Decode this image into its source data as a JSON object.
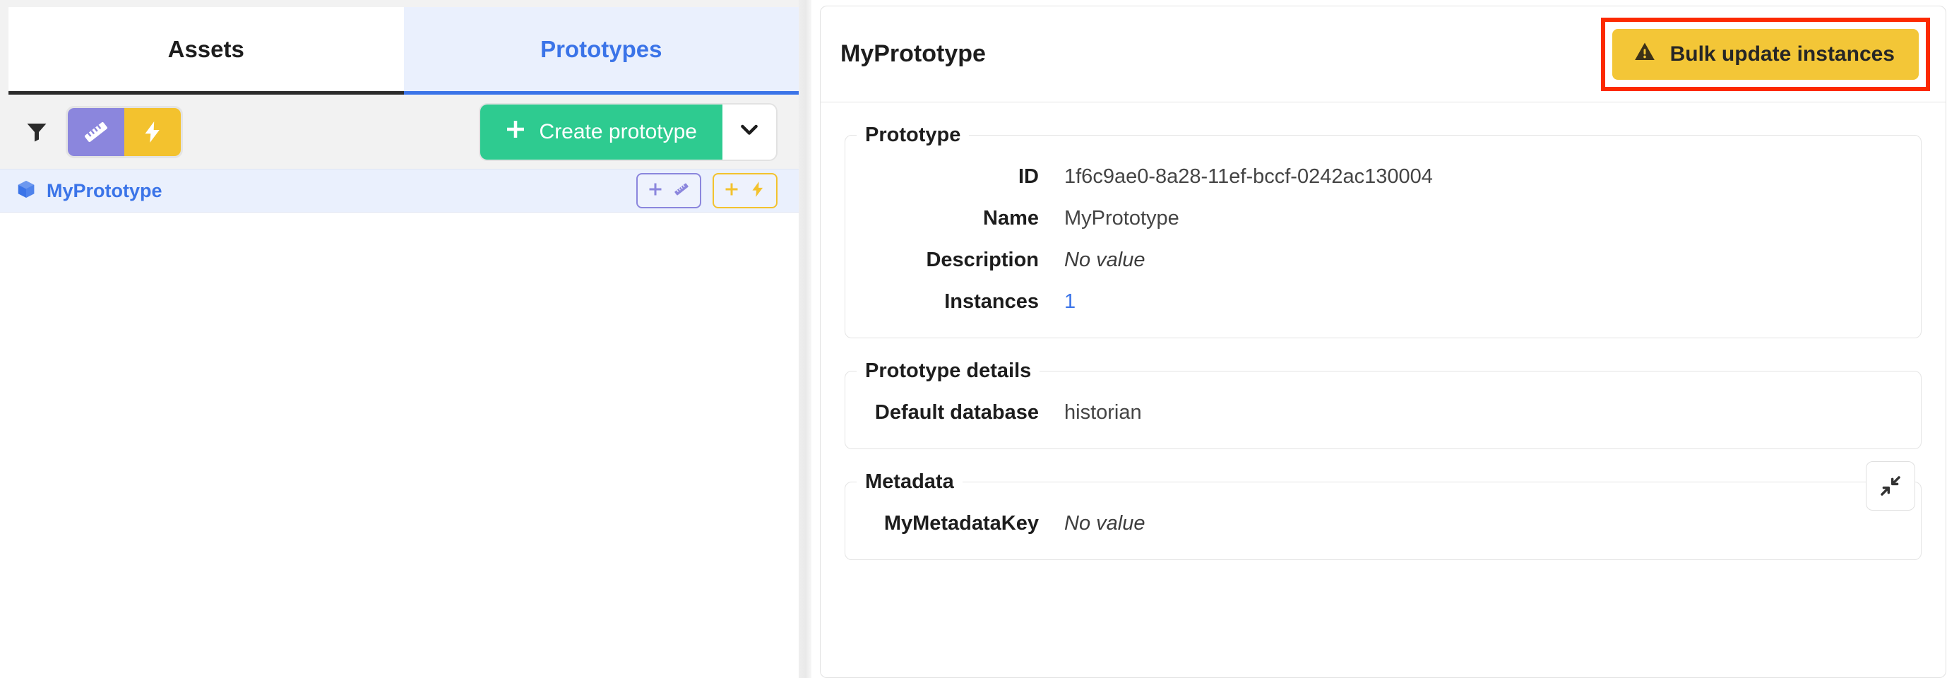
{
  "left_panel": {
    "tabs": [
      {
        "label": "Assets",
        "active": false
      },
      {
        "label": "Prototypes",
        "active": true
      }
    ],
    "toolbar": {
      "filter_icon": "filter-funnel-icon",
      "segmented": [
        {
          "icon": "ruler-icon",
          "color": "#8b86dd"
        },
        {
          "icon": "lightning-bolt-icon",
          "color": "#f3c22e"
        }
      ],
      "create_button_label": "Create prototype",
      "create_button_icon": "plus-icon",
      "create_button_color": "#2ecb90",
      "dropdown_icon": "chevron-down-icon"
    },
    "list": [
      {
        "icon": "cube-icon",
        "label": "MyPrototype",
        "actions": [
          {
            "name": "add-asset-button",
            "icons": "plus-icon ruler-icon",
            "color": "#8b86dd"
          },
          {
            "name": "add-event-button",
            "icons": "plus-icon lightning-bolt-icon",
            "color": "#f3c22e"
          }
        ]
      }
    ]
  },
  "right_panel": {
    "title": "MyPrototype",
    "bulk_button": {
      "label": "Bulk update instances",
      "icon": "warning-triangle-icon",
      "background": "#f3c637",
      "highlight_color": "#fc2a00"
    },
    "sections": [
      {
        "legend": "Prototype",
        "fields": [
          {
            "label": "ID",
            "value": "1f6c9ae0-8a28-11ef-bccf-0242ac130004",
            "style": "plain"
          },
          {
            "label": "Name",
            "value": "MyPrototype",
            "style": "plain"
          },
          {
            "label": "Description",
            "value": "No value",
            "style": "muted"
          },
          {
            "label": "Instances",
            "value": "1",
            "style": "link"
          }
        ]
      },
      {
        "legend": "Prototype details",
        "fields": [
          {
            "label": "Default database",
            "value": "historian",
            "style": "plain"
          }
        ]
      },
      {
        "legend": "Metadata",
        "collapse_icon": "collapse-arrows-icon",
        "fields": [
          {
            "label": "MyMetadataKey",
            "value": "No value",
            "style": "muted"
          }
        ]
      }
    ]
  }
}
